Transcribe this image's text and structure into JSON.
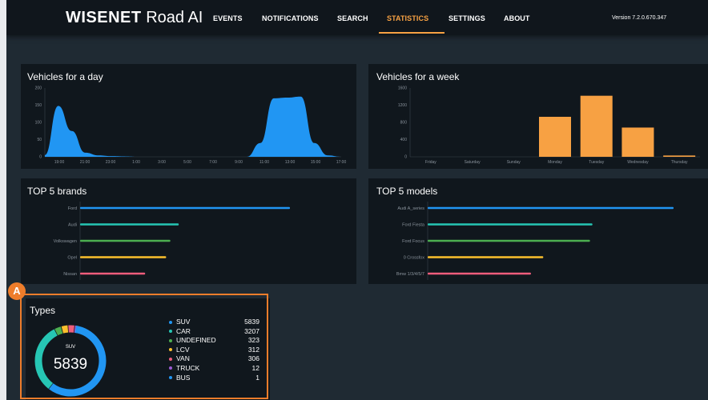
{
  "app": {
    "logo_brand": "WISENET",
    "logo_product": "Road AI",
    "version": "Version 7.2.0.670.347"
  },
  "nav": [
    {
      "label": "EVENTS",
      "active": false
    },
    {
      "label": "NOTIFICATIONS",
      "active": false
    },
    {
      "label": "SEARCH",
      "active": false
    },
    {
      "label": "STATISTICS",
      "active": true
    },
    {
      "label": "SETTINGS",
      "active": false
    },
    {
      "label": "ABOUT",
      "active": false
    }
  ],
  "callout": "A",
  "colors": {
    "accent": "#f7a143",
    "blue": "#2196f3",
    "teal": "#26c6b4",
    "green": "#4caf50",
    "yellow": "#fbc02d",
    "pink": "#ef5d7c",
    "purple": "#9c5bd6"
  },
  "chart_data": [
    {
      "type": "area",
      "title": "Vehicles for a day",
      "x_ticks": [
        "19:00",
        "21:00",
        "23:00",
        "1:00",
        "3:00",
        "5:00",
        "7:00",
        "9:00",
        "11:00",
        "13:00",
        "15:00",
        "17:00"
      ],
      "y_ticks": [
        0,
        50,
        100,
        150,
        200
      ],
      "ylim": [
        0,
        200
      ],
      "x": [
        0,
        1,
        2,
        3,
        4,
        5,
        6,
        7,
        8,
        9,
        10,
        11,
        12,
        13,
        14,
        15,
        16,
        17,
        18,
        19,
        20,
        21,
        22
      ],
      "values": [
        5,
        148,
        75,
        12,
        4,
        2,
        1,
        0,
        0,
        0,
        0,
        0,
        0,
        0,
        0,
        0,
        40,
        170,
        172,
        175,
        40,
        4,
        0
      ],
      "color": "#2196f3"
    },
    {
      "type": "bar",
      "title": "Vehicles for a week",
      "categories": [
        "Friday",
        "Saturday",
        "Sunday",
        "Monday",
        "Tuesday",
        "Wednesday",
        "Thursday"
      ],
      "values": [
        0,
        0,
        0,
        930,
        1420,
        680,
        30
      ],
      "y_ticks": [
        0,
        400,
        800,
        1200,
        1600
      ],
      "ylim": [
        0,
        1600
      ],
      "color": "#f7a143"
    },
    {
      "type": "bar",
      "orientation": "horizontal",
      "title": "TOP 5 brands",
      "categories": [
        "Ford",
        "Audi",
        "Volkswagen",
        "Opel",
        "Nissan"
      ],
      "values": [
        100,
        47,
        43,
        41,
        31
      ],
      "colors": [
        "#2196f3",
        "#26c6b4",
        "#4caf50",
        "#fbc02d",
        "#ef5d7c"
      ]
    },
    {
      "type": "bar",
      "orientation": "horizontal",
      "title": "TOP 5 models",
      "categories": [
        "Audi A_series",
        "Ford Fiesta",
        "Ford Focus",
        "0 Crossfox",
        "Bmw 1/3/4/5/7"
      ],
      "values": [
        100,
        67,
        66,
        47,
        42
      ],
      "colors": [
        "#2196f3",
        "#26c6b4",
        "#4caf50",
        "#fbc02d",
        "#ef5d7c"
      ]
    },
    {
      "type": "pie",
      "title": "Types",
      "center_label": "SUV",
      "center_value": "5839",
      "categories": [
        "SUV",
        "CAR",
        "UNDEFINED",
        "LCV",
        "VAN",
        "TRUCK",
        "BUS"
      ],
      "values": [
        5839,
        3207,
        323,
        312,
        306,
        12,
        1
      ],
      "colors": [
        "#2196f3",
        "#26c6b4",
        "#4caf50",
        "#fbc02d",
        "#ef5d7c",
        "#9c5bd6",
        "#2196f3"
      ]
    }
  ]
}
